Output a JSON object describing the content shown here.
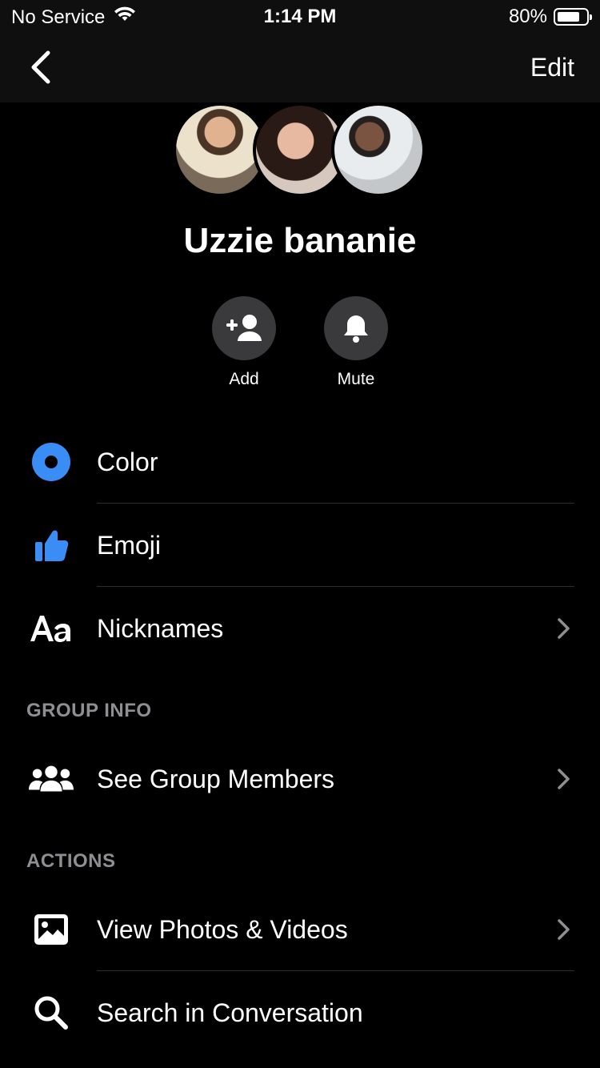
{
  "status_bar": {
    "carrier": "No Service",
    "time": "1:14 PM",
    "battery_percent": "80%",
    "battery_level": 0.8
  },
  "nav": {
    "back_icon": "chevron-left-icon",
    "edit_label": "Edit"
  },
  "conversation": {
    "name": "Uzzie bananie"
  },
  "quick_actions": [
    {
      "label": "Add",
      "icon": "add-person-icon"
    },
    {
      "label": "Mute",
      "icon": "bell-icon"
    }
  ],
  "settings": {
    "color_label": "Color",
    "emoji_label": "Emoji",
    "nicknames_label": "Nicknames"
  },
  "group_info": {
    "header": "GROUP INFO",
    "members_label": "See Group Members"
  },
  "actions": {
    "header": "ACTIONS",
    "photos_label": "View Photos & Videos",
    "search_label": "Search in Conversation"
  },
  "colors": {
    "accent": "#3a8df5",
    "background": "#000000",
    "section_header": "#8e8e93",
    "button_circle": "#3a3a3c"
  }
}
